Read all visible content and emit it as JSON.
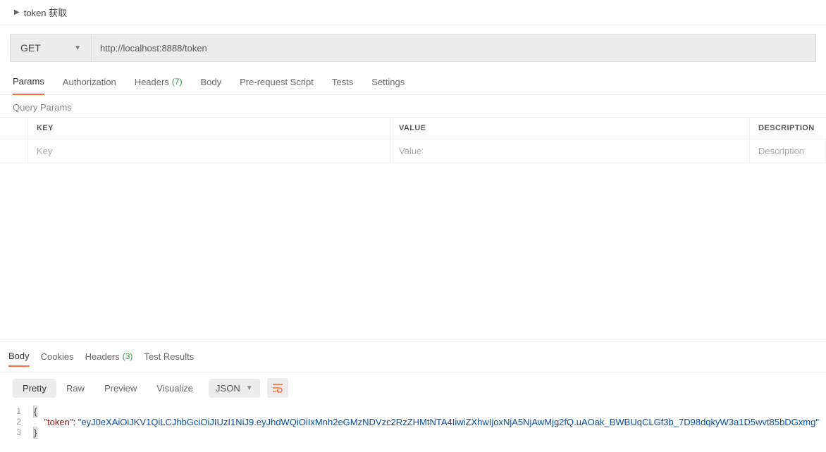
{
  "titlebar": {
    "title": "token 获取"
  },
  "request": {
    "method": "GET",
    "url": "http://localhost:8888/token"
  },
  "tabs": {
    "params": "Params",
    "auth": "Authorization",
    "headers": "Headers",
    "headers_count": "(7)",
    "body": "Body",
    "prerequest": "Pre-request Script",
    "tests": "Tests",
    "settings": "Settings"
  },
  "params_section": {
    "label": "Query Params",
    "header": {
      "key": "KEY",
      "value": "VALUE",
      "desc": "DESCRIPTION"
    },
    "placeholders": {
      "key": "Key",
      "value": "Value",
      "desc": "Description"
    }
  },
  "response_tabs": {
    "body": "Body",
    "cookies": "Cookies",
    "headers": "Headers",
    "headers_count": "(3)",
    "test_results": "Test Results"
  },
  "viewer": {
    "pretty": "Pretty",
    "raw": "Raw",
    "preview": "Preview",
    "visualize": "Visualize",
    "format": "JSON"
  },
  "response_body": {
    "lines": [
      {
        "n": "1"
      },
      {
        "n": "2"
      },
      {
        "n": "3"
      }
    ],
    "json": {
      "open": "{",
      "indent": "    ",
      "key": "\"token\"",
      "colon": ": ",
      "value": "\"eyJ0eXAiOiJKV1QiLCJhbGciOiJIUzI1NiJ9.eyJhdWQiOiIxMnh2eGMzNDVzc2RzZHMtNTA4IiwiZXhwIjoxNjA5NjAwMjg2fQ.uAOak_BWBUqCLGf3b_7D98dqkyW3a1D5wvt85bDGxmg\"",
      "close": "}"
    }
  }
}
